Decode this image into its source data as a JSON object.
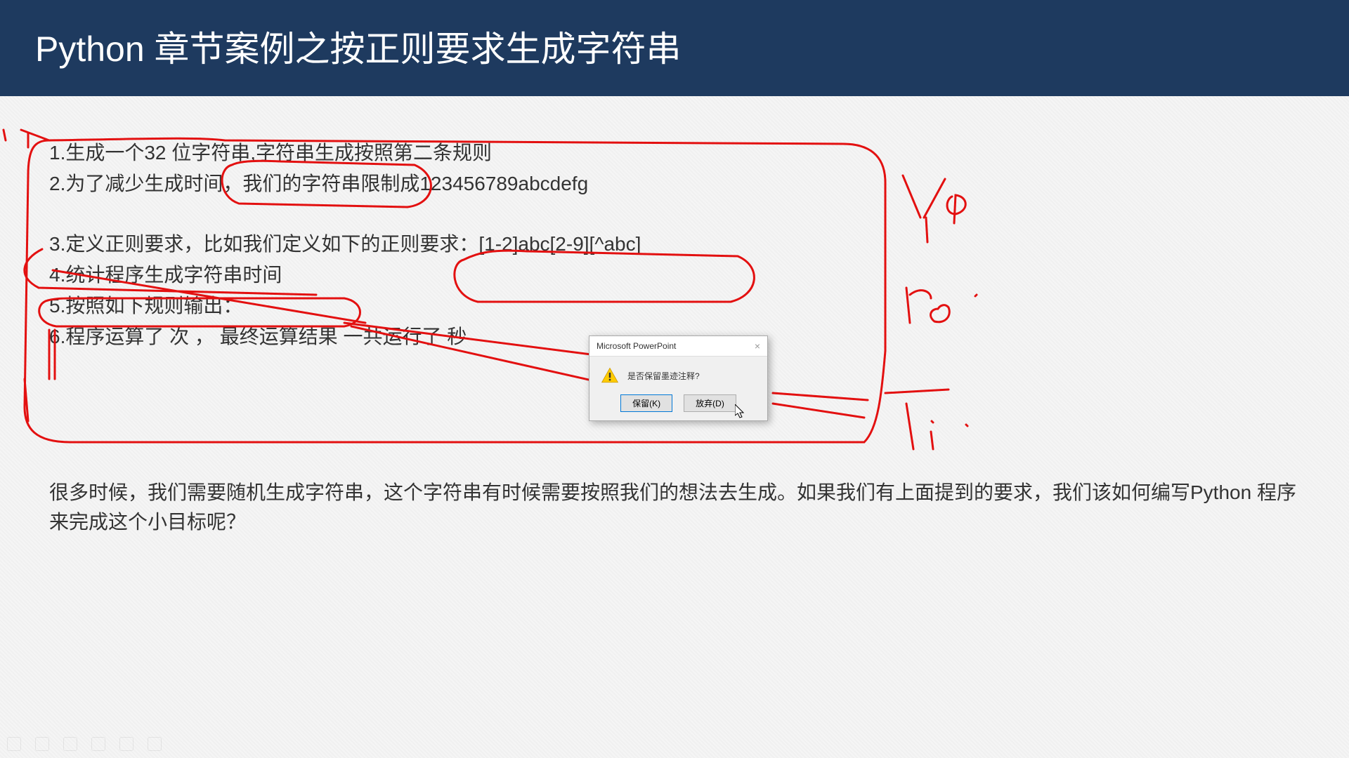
{
  "slide": {
    "title": "Python 章节案例之按正则要求生成字符串",
    "rules": {
      "r1": "1.生成一个32 位字符串,字符串生成按照第二条规则",
      "r2": "2.为了减少生成时间，我们的字符串限制成123456789abcdefg",
      "r3": "3.定义正则要求，比如我们定义如下的正则要求：[1-2]abc[2-9][^abc]",
      "r4": "4.统计程序生成字符串时间",
      "r5": "5.按照如下规则输出：",
      "r6": "6.程序运算了   次 ， 最终运算结果   一共运行了   秒"
    },
    "description": "很多时候，我们需要随机生成字符串，这个字符串有时候需要按照我们的想法去生成。如果我们有上面提到的要求，我们该如何编写Python 程序来完成这个小目标呢？",
    "annotations": {
      "note1": "Ya",
      "note2": "re",
      "note3": "Ti"
    }
  },
  "dialog": {
    "app": "Microsoft PowerPoint",
    "message": "是否保留墨迹注释?",
    "keep": "保留(K)",
    "discard": "放弃(D)",
    "close": "×"
  }
}
